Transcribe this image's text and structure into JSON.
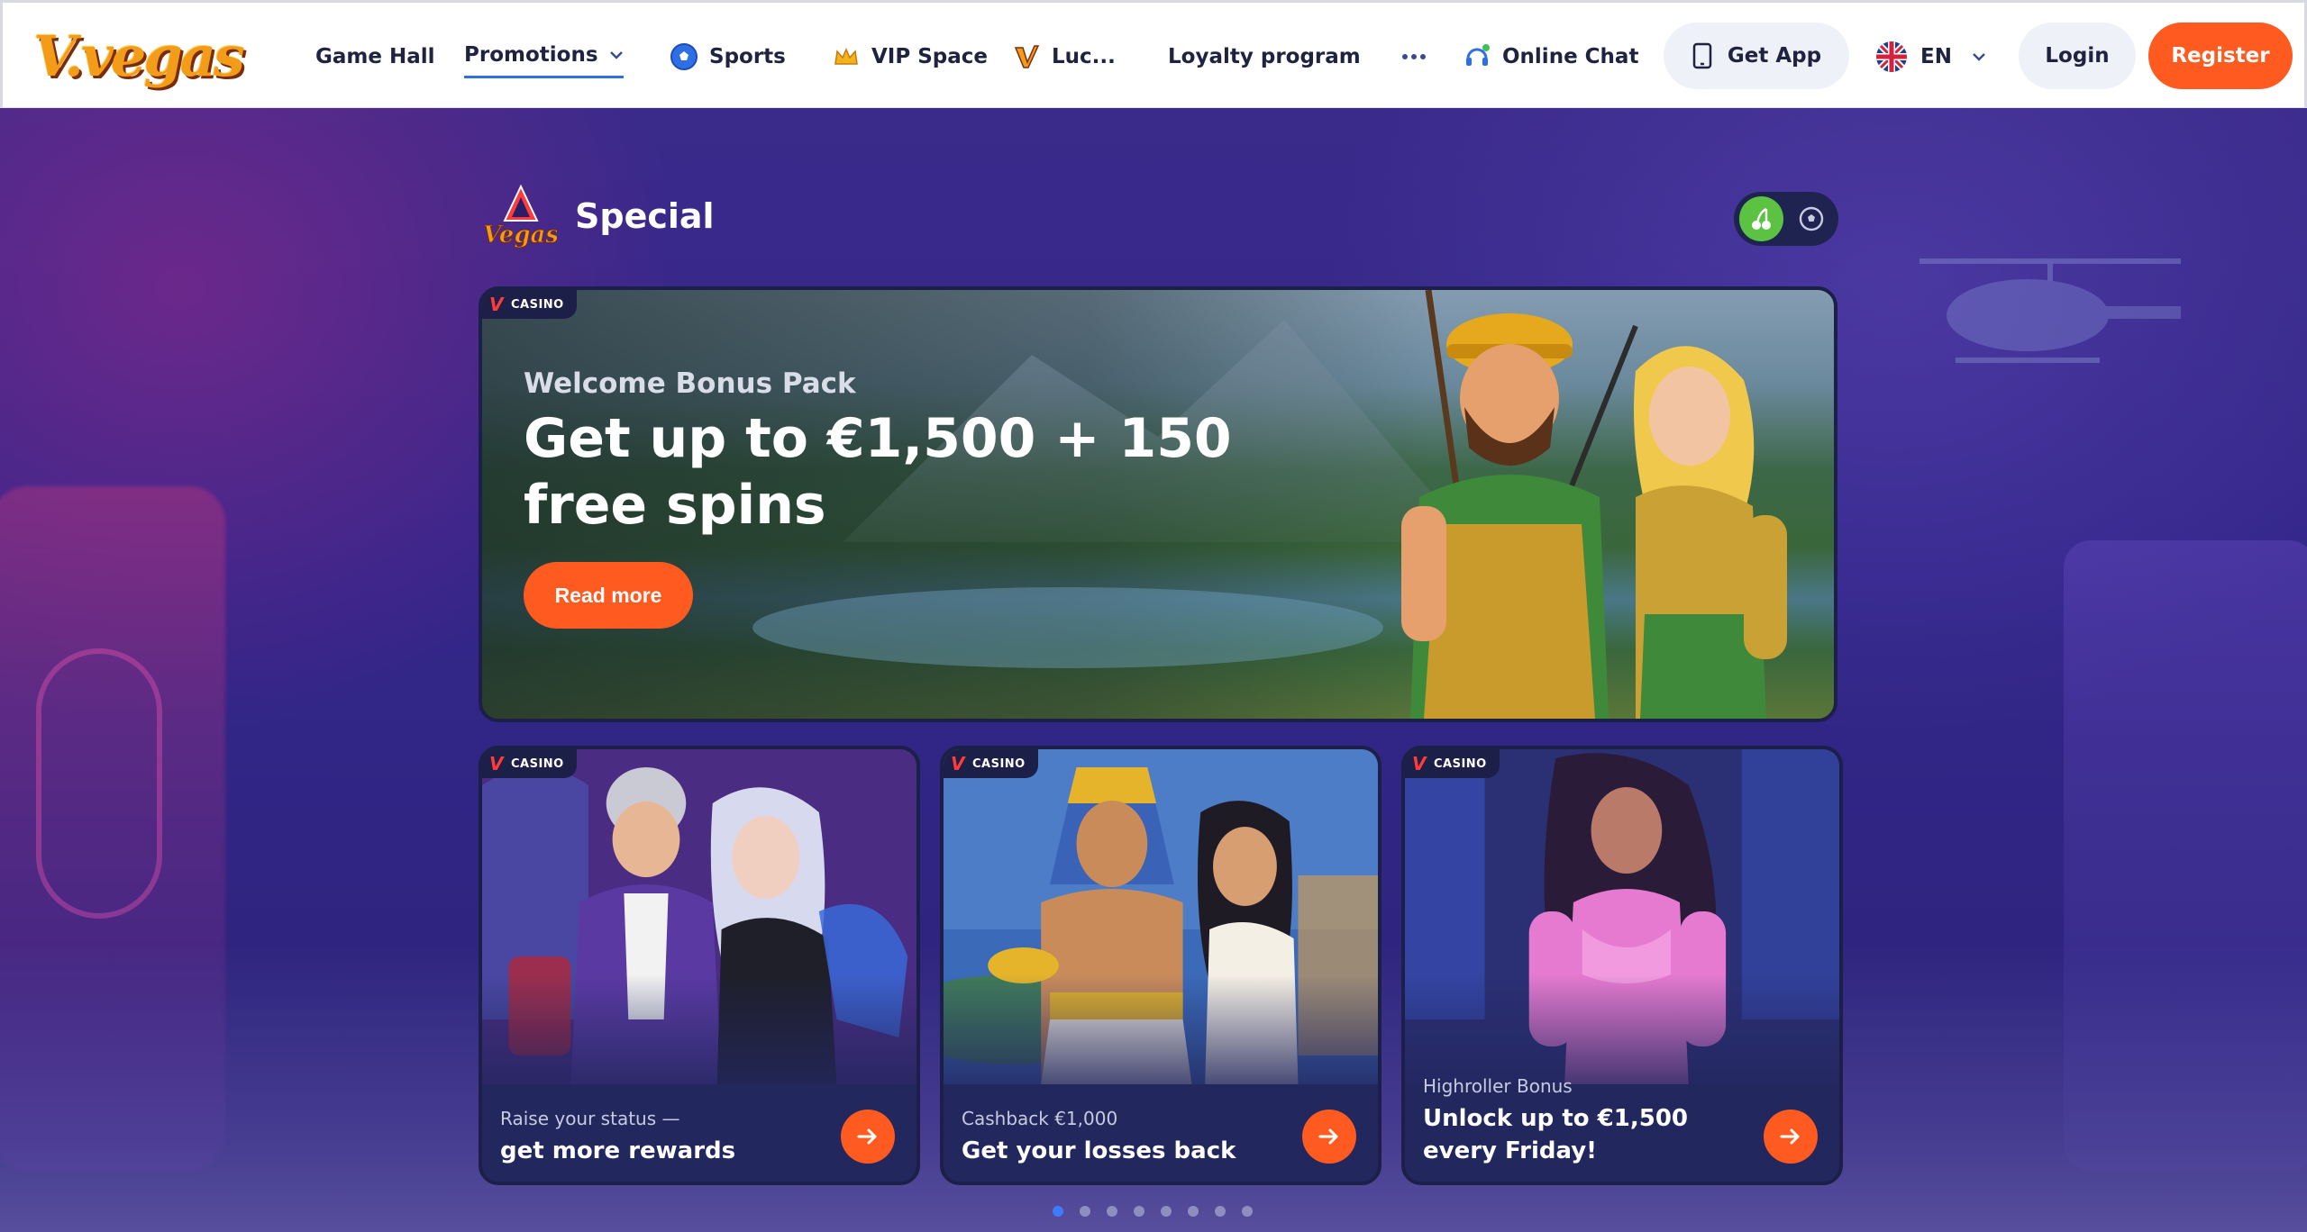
{
  "brand": {
    "logo_text": "V.vegas"
  },
  "nav": {
    "items": [
      {
        "label": "Game Hall"
      },
      {
        "label": "Promotions"
      },
      {
        "label": "Sports"
      },
      {
        "label": "VIP Space"
      },
      {
        "label": "Luc..."
      },
      {
        "label": "Loyalty program"
      },
      {
        "label": "Online Chat"
      }
    ],
    "active": "Promotions"
  },
  "header": {
    "get_app_label": "Get App",
    "language": "EN",
    "login_label": "Login",
    "register_label": "Register"
  },
  "special": {
    "title": "Special",
    "logo_text": "Vegas",
    "toggle": {
      "options": [
        "slots-icon",
        "football-icon"
      ],
      "selected": "slots-icon"
    }
  },
  "hero": {
    "badge": "CASINO",
    "subtitle": "Welcome Bonus Pack",
    "title": "Get up to €1,500 + 150 free spins",
    "button_label": "Read more"
  },
  "cards": [
    {
      "badge": "CASINO",
      "subtitle": "Raise your status —",
      "title": "get more rewards"
    },
    {
      "badge": "CASINO",
      "subtitle": "Cashback €1,000",
      "title": "Get your losses back"
    },
    {
      "badge": "CASINO",
      "subtitle": "Highroller Bonus",
      "title": "Unlock up to €1,500 every Friday!"
    }
  ],
  "pagination": {
    "count": 8,
    "active_index": 0
  },
  "colors": {
    "accent": "#ff5a1f",
    "nav_active_underline": "#2f6fe6",
    "toggle_on": "#5bc242",
    "dot_active": "#3d7bff"
  }
}
